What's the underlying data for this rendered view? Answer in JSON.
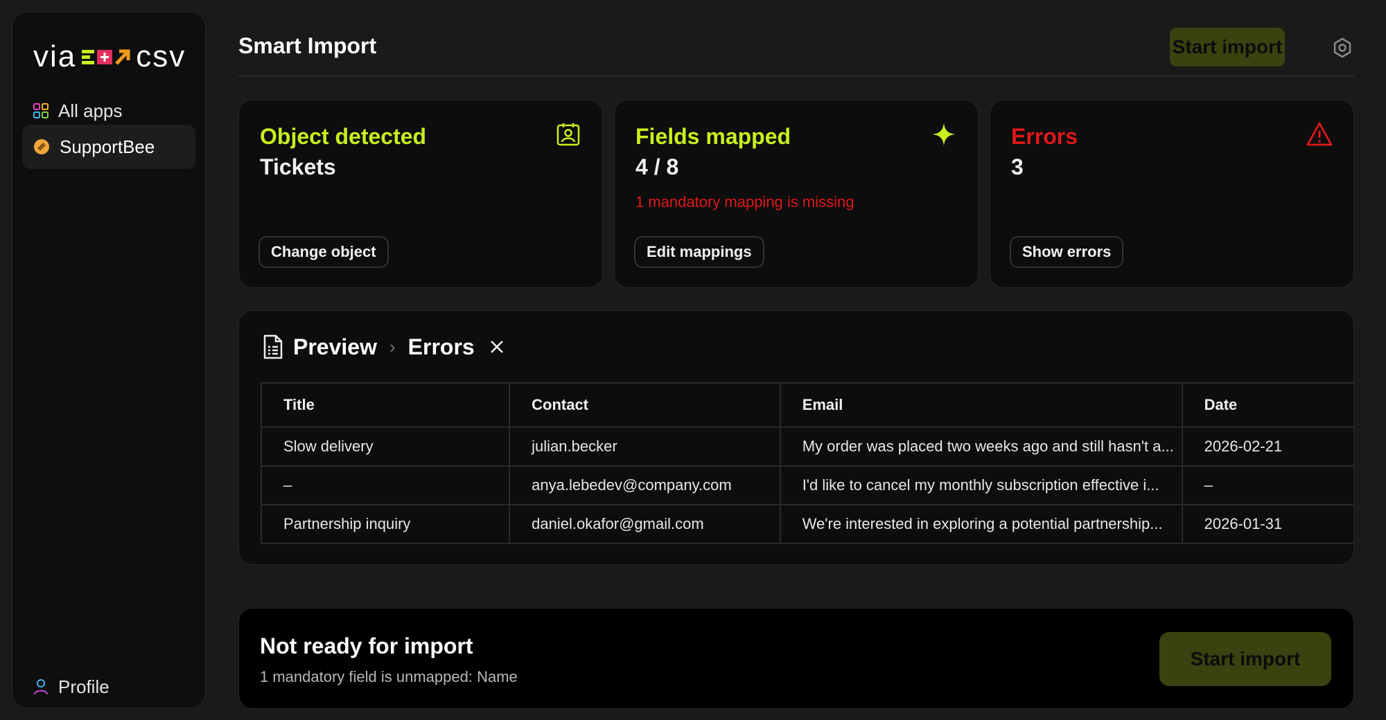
{
  "app": {
    "logo_left": "via",
    "logo_right": "csv"
  },
  "sidebar": {
    "items": [
      {
        "label": "All apps",
        "icon": "grid-icon"
      },
      {
        "label": "SupportBee",
        "icon": "supportbee-icon",
        "active": true
      }
    ],
    "profile": {
      "label": "Profile",
      "icon": "user-icon"
    }
  },
  "header": {
    "title": "Smart Import",
    "start_import_label": "Start import",
    "settings_icon": "gear-icon"
  },
  "cards": {
    "object": {
      "label": "Object detected",
      "value": "Tickets",
      "button": "Change object",
      "icon": "contact-card-icon"
    },
    "fields": {
      "label": "Fields mapped",
      "value": "4 / 8",
      "warning": "1 mandatory mapping is missing",
      "button": "Edit mappings",
      "icon": "sparkle-icon"
    },
    "errors": {
      "label": "Errors",
      "value": "3",
      "button": "Show errors",
      "icon": "warning-icon"
    }
  },
  "preview": {
    "title": "Preview",
    "filter": "Errors",
    "columns": [
      "Title",
      "Contact",
      "Email",
      "Date"
    ],
    "rows": [
      [
        "Slow delivery",
        "julian.becker",
        "My order was placed two weeks ago and still hasn't a...",
        "2026-02-21"
      ],
      [
        "–",
        "anya.lebedev@company.com",
        "I'd like to cancel my monthly subscription effective i...",
        "–"
      ],
      [
        "Partnership inquiry",
        "daniel.okafor@gmail.com",
        "We're interested in exploring a potential partnership...",
        "2026-01-31"
      ]
    ]
  },
  "footer": {
    "title": "Not ready for import",
    "subtitle": "1 mandatory field is unmapped: Name",
    "start_import_label": "Start import"
  },
  "colors": {
    "accent": "#c8f01e",
    "error": "#e01818",
    "button_disabled_bg": "#3a4210"
  }
}
